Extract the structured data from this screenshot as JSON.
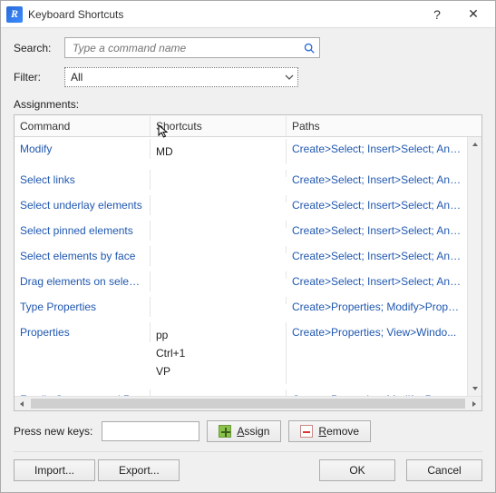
{
  "titlebar": {
    "app_letter": "R",
    "title": "Keyboard Shortcuts",
    "help": "?",
    "close": "✕"
  },
  "labels": {
    "search": "Search:",
    "filter": "Filter:",
    "assignments": "Assignments:",
    "press_new_keys": "Press new keys:"
  },
  "search": {
    "placeholder": "Type a command name"
  },
  "filter": {
    "value": "All"
  },
  "columns": {
    "command": "Command",
    "shortcuts": "Shortcuts",
    "paths": "Paths"
  },
  "rows": [
    {
      "command": "Modify",
      "shortcuts": [
        "MD"
      ],
      "paths": "Create>Select; Insert>Select; Ann..."
    },
    {
      "command": "Select links",
      "shortcuts": [],
      "paths": "Create>Select; Insert>Select; Ann..."
    },
    {
      "command": "Select underlay elements",
      "shortcuts": [],
      "paths": "Create>Select; Insert>Select; Ann..."
    },
    {
      "command": "Select pinned elements",
      "shortcuts": [],
      "paths": "Create>Select; Insert>Select; Ann..."
    },
    {
      "command": "Select elements by face",
      "shortcuts": [],
      "paths": "Create>Select; Insert>Select; Ann..."
    },
    {
      "command": "Drag elements on select...",
      "shortcuts": [],
      "paths": "Create>Select; Insert>Select; Ann..."
    },
    {
      "command": "Type Properties",
      "shortcuts": [],
      "paths": "Create>Properties; Modify>Prope..."
    },
    {
      "command": "Properties",
      "shortcuts": [
        "pp",
        "Ctrl+1",
        "VP"
      ],
      "paths": "Create>Properties; View>Windo..."
    },
    {
      "command": "Family Category and Par...",
      "shortcuts": [],
      "paths": "Create>Properties; Modify>Prope..."
    }
  ],
  "buttons": {
    "assign_pre": "A",
    "assign_rest": "ssign",
    "remove_pre": "R",
    "remove_rest": "emove",
    "import": "Import...",
    "export": "Export...",
    "ok": "OK",
    "cancel": "Cancel"
  }
}
